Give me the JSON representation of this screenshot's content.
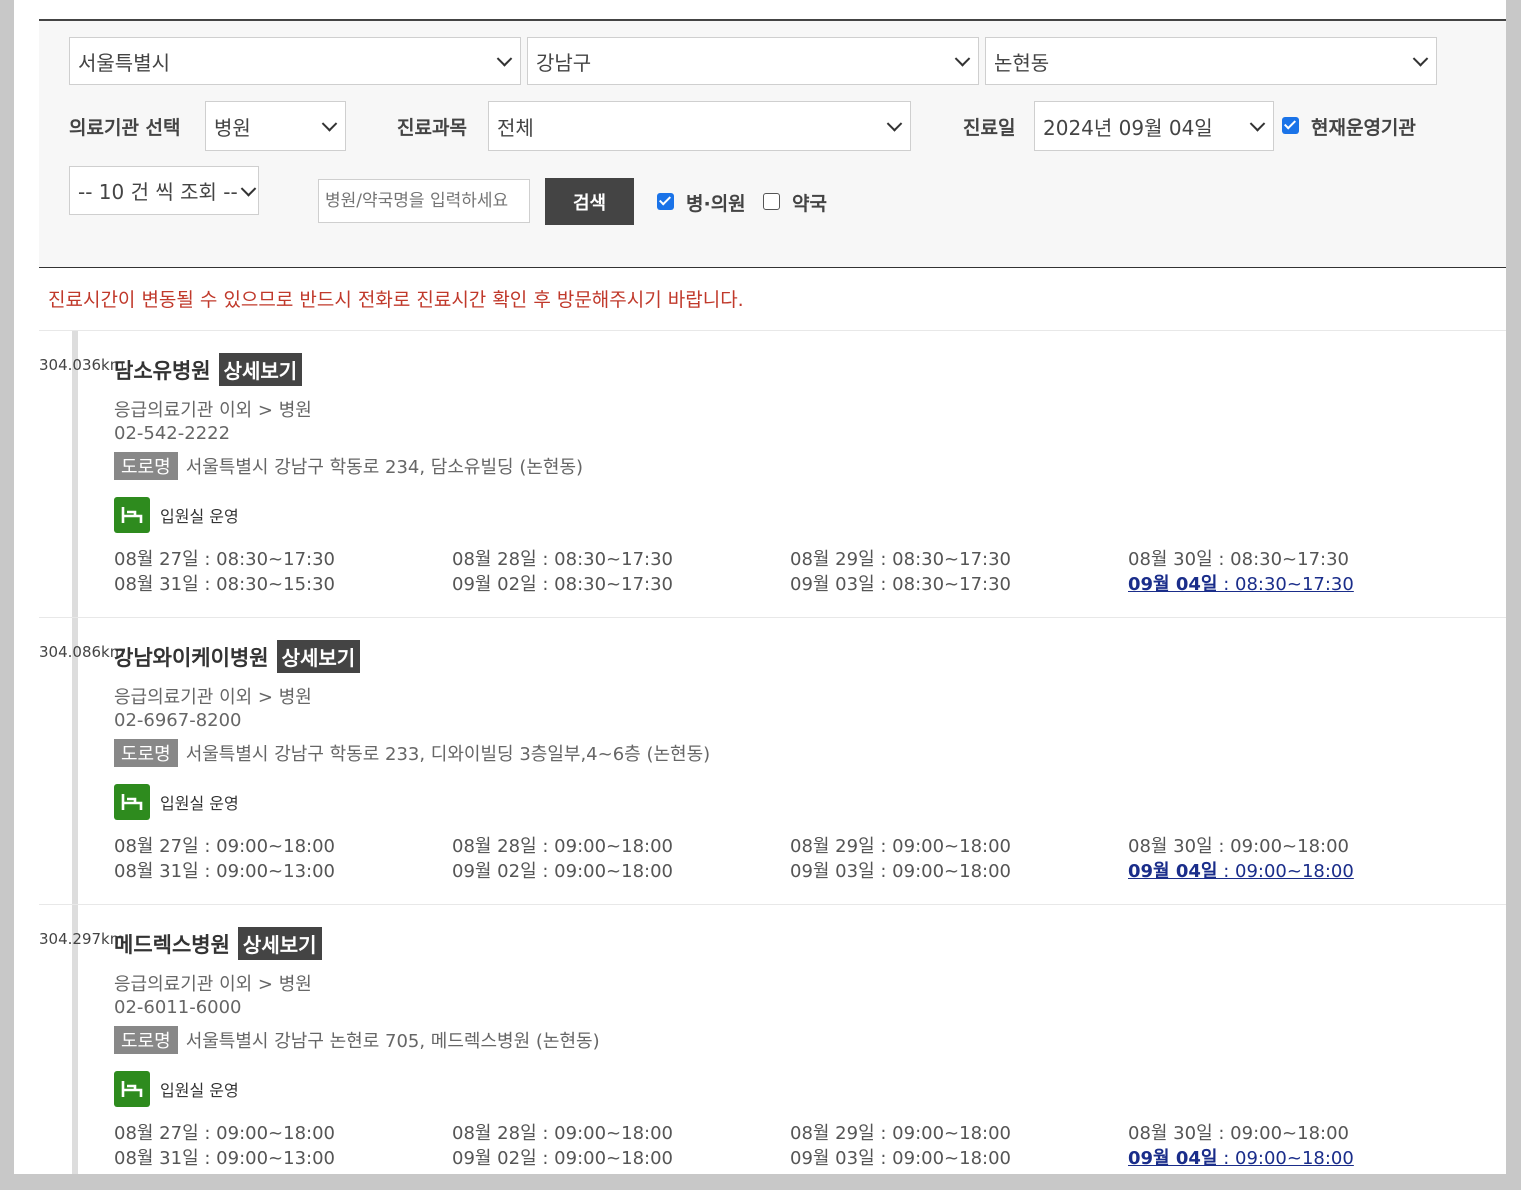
{
  "filters": {
    "sido": "서울특별시",
    "sigungu": "강남구",
    "dong": "논현동",
    "institution_label": "의료기관 선택",
    "institution_value": "병원",
    "department_label": "진료과목",
    "department_value": "전체",
    "date_label": "진료일",
    "date_value": "2024년 09월 04일",
    "operating_label": "현재운영기관",
    "page_size": "-- 10 건 씩 조회 --",
    "search_placeholder": "병원/약국명을 입력하세요",
    "search_button": "검색",
    "hospital_clinic_label": "병·의원",
    "pharmacy_label": "약국"
  },
  "notice": "진료시간이 변동될 수 있으므로 반드시 전화로 진료시간 확인 후 방문해주시기 바랍니다.",
  "results": [
    {
      "distance": "304.036km",
      "name": "담소유병원",
      "detail": "상세보기",
      "category": "응급의료기관 이외 > 병원",
      "phone": "02-542-2222",
      "road_label": "도로명",
      "address": "서울특별시 강남구 학동로 234, 담소유빌딩 (논현동)",
      "ward": "입원실 운영",
      "hours": [
        {
          "date": "08월 27일",
          "time": " : 08:30~17:30"
        },
        {
          "date": "08월 28일",
          "time": " : 08:30~17:30"
        },
        {
          "date": "08월 29일",
          "time": " : 08:30~17:30"
        },
        {
          "date": "08월 30일",
          "time": " : 08:30~17:30"
        },
        {
          "date": "08월 31일",
          "time": " : 08:30~15:30"
        },
        {
          "date": "09월 02일",
          "time": " : 08:30~17:30"
        },
        {
          "date": "09월 03일",
          "time": " : 08:30~17:30"
        },
        {
          "date": "09월 04일",
          "time": " : 08:30~17:30"
        }
      ]
    },
    {
      "distance": "304.086km",
      "name": "강남와이케이병원",
      "detail": "상세보기",
      "category": "응급의료기관 이외 > 병원",
      "phone": "02-6967-8200",
      "road_label": "도로명",
      "address": "서울특별시 강남구 학동로 233, 디와이빌딩 3층일부,4~6층 (논현동)",
      "ward": "입원실 운영",
      "hours": [
        {
          "date": "08월 27일",
          "time": " : 09:00~18:00"
        },
        {
          "date": "08월 28일",
          "time": " : 09:00~18:00"
        },
        {
          "date": "08월 29일",
          "time": " : 09:00~18:00"
        },
        {
          "date": "08월 30일",
          "time": " : 09:00~18:00"
        },
        {
          "date": "08월 31일",
          "time": " : 09:00~13:00"
        },
        {
          "date": "09월 02일",
          "time": " : 09:00~18:00"
        },
        {
          "date": "09월 03일",
          "time": " : 09:00~18:00"
        },
        {
          "date": "09월 04일",
          "time": " : 09:00~18:00"
        }
      ]
    },
    {
      "distance": "304.297km",
      "name": "메드렉스병원",
      "detail": "상세보기",
      "category": "응급의료기관 이외 > 병원",
      "phone": "02-6011-6000",
      "road_label": "도로명",
      "address": "서울특별시 강남구 논현로 705, 메드렉스병원 (논현동)",
      "ward": "입원실 운영",
      "hours": [
        {
          "date": "08월 27일",
          "time": " : 09:00~18:00"
        },
        {
          "date": "08월 28일",
          "time": " : 09:00~18:00"
        },
        {
          "date": "08월 29일",
          "time": " : 09:00~18:00"
        },
        {
          "date": "08월 30일",
          "time": " : 09:00~18:00"
        },
        {
          "date": "08월 31일",
          "time": " : 09:00~13:00"
        },
        {
          "date": "09월 02일",
          "time": " : 09:00~18:00"
        },
        {
          "date": "09월 03일",
          "time": " : 09:00~18:00"
        },
        {
          "date": "09월 04일",
          "time": " : 09:00~18:00"
        }
      ]
    }
  ]
}
